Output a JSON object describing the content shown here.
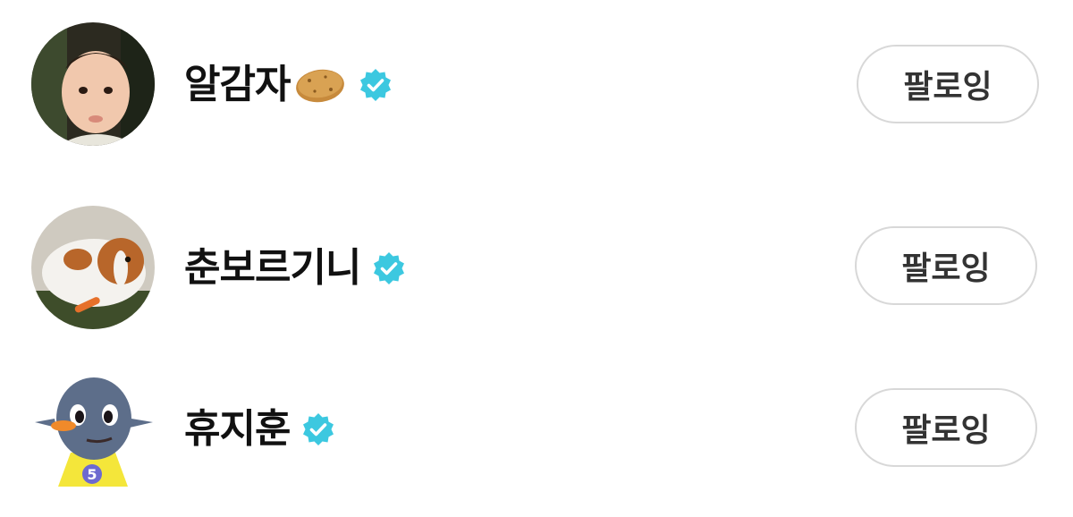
{
  "follow_list": {
    "items": [
      {
        "name": "알감자",
        "emoji_icon": "potato-icon",
        "verified": true,
        "button_label": "팔로잉",
        "avatar_desc": "baby-photo"
      },
      {
        "name": "춘보르기니",
        "verified": true,
        "button_label": "팔로잉",
        "avatar_desc": "guinea-pig-photo"
      },
      {
        "name": "휴지훈",
        "verified": true,
        "button_label": "팔로잉",
        "avatar_desc": "bird-character"
      }
    ]
  },
  "colors": {
    "verified_badge": "#3cc8e0",
    "button_border": "#d8d8d8",
    "button_text": "#333333",
    "name_text": "#111111"
  }
}
